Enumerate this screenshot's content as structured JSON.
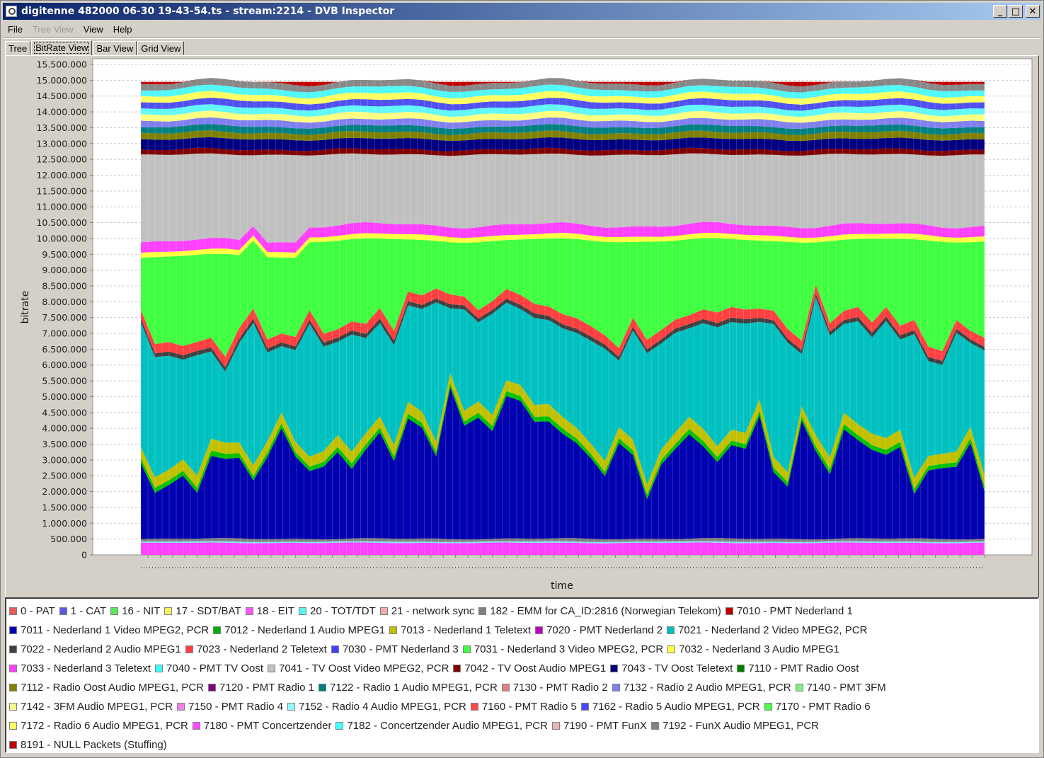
{
  "window": {
    "title": "digitenne 482000 06-30 19-43-54.ts - stream:2214 - DVB Inspector",
    "buttons": {
      "minimize": "_",
      "maximize": "□",
      "close": "✕"
    }
  },
  "menu": [
    {
      "label": "File",
      "enabled": true
    },
    {
      "label": "Tree View",
      "enabled": false
    },
    {
      "label": "View",
      "enabled": true
    },
    {
      "label": "Help",
      "enabled": true
    }
  ],
  "tabs": [
    {
      "label": "Tree",
      "active": false
    },
    {
      "label": "BitRate View",
      "active": true
    },
    {
      "label": "Bar View",
      "active": false
    },
    {
      "label": "Grid View",
      "active": false
    }
  ],
  "chart_data": {
    "type": "area",
    "stacked": true,
    "title": "",
    "xlabel": "time",
    "ylabel": "bitrate",
    "ylim": [
      0,
      15500000
    ],
    "yticks": [
      0,
      500000,
      1000000,
      1500000,
      2000000,
      2500000,
      3000000,
      3500000,
      4000000,
      4500000,
      5000000,
      5500000,
      6000000,
      6500000,
      7000000,
      7500000,
      8000000,
      8500000,
      9000000,
      9500000,
      10000000,
      10500000,
      11000000,
      11500000,
      12000000,
      12500000,
      13000000,
      13500000,
      14000000,
      14500000,
      15000000,
      15500000
    ],
    "ytick_labels": [
      "0",
      "500.000",
      "1.000.000",
      "1.500.000",
      "2.000.000",
      "2.500.000",
      "3.000.000",
      "3.500.000",
      "4.000.000",
      "4.500.000",
      "5.000.000",
      "5.500.000",
      "6.000.000",
      "6.500.000",
      "7.000.000",
      "7.500.000",
      "8.000.000",
      "8.500.000",
      "9.000.000",
      "9.500.000",
      "10.000.000",
      "10.500.000",
      "11.000.000",
      "11.500.000",
      "12.000.000",
      "12.500.000",
      "13.000.000",
      "13.500.000",
      "14.000.000",
      "14.500.000",
      "15.000.000",
      "15.500.000"
    ],
    "grid": true,
    "legend_position": "bottom",
    "num_points": 61,
    "stack_order_bottom_to_top": [
      "7033b",
      "7040b",
      "7192b",
      "7011",
      "7012",
      "7013",
      "7021",
      "7022",
      "7023",
      "7031",
      "7032",
      "7033",
      "7041",
      "7042",
      "7043",
      "7112",
      "7122",
      "7132",
      "7142",
      "7152",
      "7162",
      "7172",
      "7182",
      "7192",
      "8191"
    ],
    "series_key_values": {
      "7011 - Nederland 1 Video MPEG2, PCR": [
        2400000,
        1450000,
        1700000,
        2000000,
        1450000,
        2600000,
        2500000,
        2550000,
        1850000,
        2600000,
        3500000,
        2600000,
        2150000,
        2300000,
        2750000,
        2200000,
        2800000,
        3350000,
        2450000,
        3800000,
        3500000,
        2600000,
        4800000,
        3600000,
        3850000,
        3400000,
        4500000,
        4350000,
        3700000,
        3700000,
        3300000,
        3000000,
        2550000,
        2000000,
        3050000,
        2650000,
        1250000,
        2350000,
        2850000,
        3300000,
        2900000,
        2400000,
        2950000,
        2850000,
        3900000,
        2100000,
        1650000,
        3750000,
        2800000,
        2050000,
        3450000,
        3100000,
        2800000,
        2650000,
        2900000,
        1400000,
        2150000,
        2250000,
        2300000,
        3050000,
        1500000
      ],
      "7021 - Nederland 2 Video MPEG2, PCR": [
        3950000,
        3800000,
        3600000,
        3150000,
        3800000,
        2750000,
        2250000,
        3150000,
        4500000,
        2800000,
        2100000,
        2900000,
        4200000,
        3300000,
        2950000,
        3700000,
        3000000,
        2950000,
        3150000,
        3050000,
        3250000,
        4400000,
        2050000,
        3200000,
        2500000,
        3200000,
        2450000,
        2400000,
        2750000,
        2650000,
        2800000,
        3000000,
        3250000,
        3550000,
        2100000,
        3450000,
        4150000,
        3350000,
        3150000,
        2800000,
        3350000,
        3750000,
        3400000,
        3450000,
        2450000,
        4200000,
        4100000,
        1650000,
        4350000,
        3850000,
        2800000,
        3250000,
        3050000,
        3700000,
        2850000,
        4550000,
        3000000,
        2800000,
        3750000,
        2650000,
        3950000
      ],
      "7031 - Nederland 3 Video MPEG2, PCR": [
        1650000,
        2750000,
        2700000,
        2850000,
        2750000,
        2650000,
        3250000,
        2300000,
        2150000,
        2600000,
        2400000,
        2500000,
        2150000,
        2900000,
        2800000,
        2600000,
        2700000,
        2200000,
        2900000,
        1650000,
        1750000,
        1500000,
        1650000,
        1700000,
        2150000,
        1900000,
        1550000,
        1750000,
        2050000,
        2150000,
        2400000,
        2500000,
        2700000,
        2950000,
        3350000,
        2400000,
        3100000,
        2800000,
        2500000,
        2400000,
        2250000,
        2350000,
        2150000,
        2200000,
        2150000,
        2200000,
        2750000,
        3100000,
        1350000,
        2600000,
        2250000,
        2150000,
        2650000,
        2150000,
        2750000,
        2550000,
        3350000,
        3450000,
        2450000,
        2800000,
        3050000
      ]
    },
    "series_approx_constant": {
      "7012 - Nederland 1 Audio MPEG1": 150000,
      "7013 - Nederland 1 Teletext": 350000,
      "7022 - Nederland 2 Audio MPEG1": 130000,
      "7023 - Nederland 2 Teletext": 300000,
      "7032 - Nederland 3 Audio MPEG1": 160000,
      "7033 - Nederland 3 Teletext": 320000,
      "7041 - TV Oost Video MPEG2, PCR": 2700000,
      "7042 - TV Oost Audio MPEG1": 160000,
      "7043 - TV Oost Teletext": 330000,
      "7112 - Radio Oost Audio MPEG1, PCR": 200000,
      "7122 - Radio 1 Audio MPEG1, PCR": 200000,
      "7132 - Radio 2 Audio MPEG1, PCR": 200000,
      "7142 - 3FM Audio MPEG1, PCR": 200000,
      "7152 - Radio 4 Audio MPEG1, PCR": 200000,
      "7162 - Radio 5 Audio MPEG1, PCR": 200000,
      "7172 - Radio 6 Audio MPEG1, PCR": 200000,
      "7182 - Concertzender Audio MPEG1, PCR": 200000,
      "7192 - FunX Audio MPEG1, PCR": 200000,
      "8191 - NULL Packets (Stuffing)": 200000,
      "bottom_magenta": 380000,
      "bottom_cyan": 40000,
      "bottom_grey": 90000
    },
    "total_bitrate_approx": 14950000
  },
  "legend": {
    "rows": [
      [
        {
          "label": "0 - PAT",
          "color": "#e85c5c"
        },
        {
          "label": "1 - CAT",
          "color": "#5a5ae8"
        },
        {
          "label": "16 - NIT",
          "color": "#5ae85a"
        },
        {
          "label": "17 - SDT/BAT",
          "color": "#f5f55a"
        },
        {
          "label": "18 - EIT",
          "color": "#f55af5"
        },
        {
          "label": "20 - TOT/TDT",
          "color": "#5af5f5"
        },
        {
          "label": "21 - network sync",
          "color": "#f0b0b0"
        },
        {
          "label": "182 - EMM for CA_ID:2816 (Norwegian Telekom)",
          "color": "#808080"
        },
        {
          "label": "7010 - PMT Nederland 1",
          "color": "#c00000"
        }
      ],
      [
        {
          "label": "7011 - Nederland 1 Video MPEG2, PCR",
          "color": "#0000b0"
        },
        {
          "label": "7012 - Nederland 1 Audio MPEG1",
          "color": "#00b000"
        },
        {
          "label": "7013 - Nederland 1 Teletext",
          "color": "#c0c000"
        },
        {
          "label": "7020 - PMT Nederland 2",
          "color": "#c000c0"
        },
        {
          "label": "7021 - Nederland 2 Video MPEG2, PCR",
          "color": "#00c0c0"
        }
      ],
      [
        {
          "label": "7022 - Nederland 2 Audio MPEG1",
          "color": "#404040"
        },
        {
          "label": "7023 - Nederland 2 Teletext",
          "color": "#ff4040"
        },
        {
          "label": "7030 - PMT Nederland 3",
          "color": "#4040ff"
        },
        {
          "label": "7031 - Nederland 3 Video MPEG2, PCR",
          "color": "#40ff40"
        },
        {
          "label": "7032 - Nederland 3 Audio MPEG1",
          "color": "#ffff40"
        }
      ],
      [
        {
          "label": "7033 - Nederland 3 Teletext",
          "color": "#ff40ff"
        },
        {
          "label": "7040 - PMT TV Oost",
          "color": "#40ffff"
        },
        {
          "label": "7041 - TV Oost Video MPEG2, PCR",
          "color": "#c0c0c0"
        },
        {
          "label": "7042 - TV Oost Audio MPEG1",
          "color": "#800000"
        },
        {
          "label": "7043 - TV Oost Teletext",
          "color": "#000080"
        },
        {
          "label": "7110 - PMT Radio Oost",
          "color": "#008000"
        }
      ],
      [
        {
          "label": "7112 - Radio Oost Audio MPEG1, PCR",
          "color": "#808000"
        },
        {
          "label": "7120 - PMT Radio 1",
          "color": "#800080"
        },
        {
          "label": "7122 - Radio 1 Audio MPEG1, PCR",
          "color": "#008080"
        },
        {
          "label": "7130 - PMT Radio 2",
          "color": "#e08080"
        },
        {
          "label": "7132 - Radio 2 Audio MPEG1, PCR",
          "color": "#8080f0"
        },
        {
          "label": "7140 - PMT 3FM",
          "color": "#80f080"
        }
      ],
      [
        {
          "label": "7142 - 3FM Audio MPEG1, PCR",
          "color": "#f8f890"
        },
        {
          "label": "7150 - PMT Radio 4",
          "color": "#f080f0"
        },
        {
          "label": "7152 - Radio 4 Audio MPEG1, PCR",
          "color": "#90f8f8"
        },
        {
          "label": "7160 - PMT Radio 5",
          "color": "#ff4848"
        },
        {
          "label": "7162 - Radio 5 Audio MPEG1, PCR",
          "color": "#4848ff"
        },
        {
          "label": "7170 - PMT Radio 6",
          "color": "#48ff48"
        }
      ],
      [
        {
          "label": "7172 - Radio 6 Audio MPEG1, PCR",
          "color": "#ffff60"
        },
        {
          "label": "7180 - PMT Concertzender",
          "color": "#ff48ff"
        },
        {
          "label": "7182 - Concertzender Audio MPEG1, PCR",
          "color": "#48ffff"
        },
        {
          "label": "7190 - PMT FunX",
          "color": "#e8b8b8"
        },
        {
          "label": "7192 - FunX Audio MPEG1, PCR",
          "color": "#808080"
        }
      ],
      [
        {
          "label": "8191 - NULL Packets (Stuffing)",
          "color": "#c00000"
        }
      ]
    ]
  }
}
